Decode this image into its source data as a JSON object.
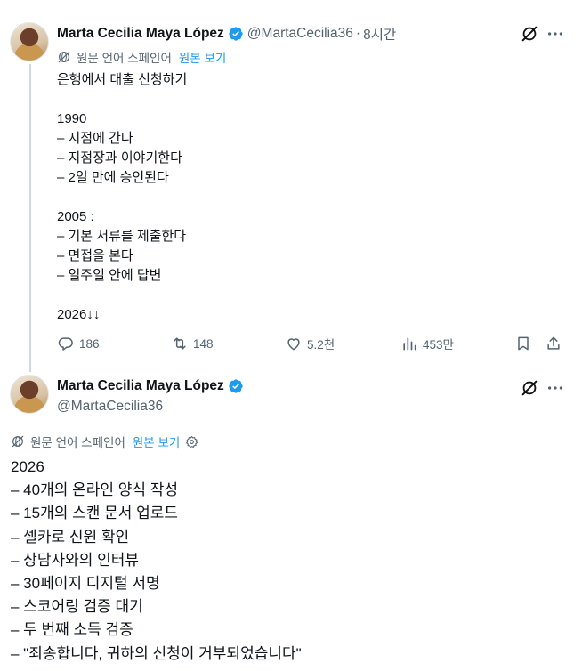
{
  "tweet1": {
    "author_name": "Marta Cecilia Maya López",
    "handle": "@MartaCecilia36",
    "separator": "·",
    "time": "8시간",
    "translation": {
      "label": "원문 언어 스페인어",
      "link": "원본 보기"
    },
    "lines": [
      "은행에서 대출 신청하기",
      "",
      "1990",
      "– 지점에 간다",
      "– 지점장과 이야기한다",
      "– 2일 만에 승인된다",
      "",
      "2005 :",
      "– 기본 서류를 제출한다",
      "– 면접을 본다",
      "– 일주일 안에 답변",
      "",
      "2026↓↓"
    ],
    "actions": {
      "replies": "186",
      "retweets": "148",
      "likes": "5.2천",
      "views": "453만"
    }
  },
  "tweet2": {
    "author_name": "Marta Cecilia Maya López",
    "handle": "@MartaCecilia36",
    "translation": {
      "label": "원문 언어 스페인어",
      "link": "원본 보기"
    },
    "lines": [
      "2026",
      "– 40개의 온라인 양식 작성",
      "– 15개의 스캔 문서 업로드",
      "– 셀카로 신원 확인",
      "– 상담사와의 인터뷰",
      "– 30페이지 디지털 서명",
      "– 스코어링 검증 대기",
      "– 두 번째 소득 검증",
      "– \"죄송합니다, 귀하의 신청이 거부되었습니다\""
    ]
  },
  "colors": {
    "text": "#0f1419",
    "secondary": "#536471",
    "link": "#1d9bf0",
    "verified": "#1d9bf0",
    "thread_line": "#cfd9de"
  },
  "icons": [
    "verified-badge-icon",
    "grok-icon",
    "more-icon",
    "translate-globe-icon",
    "settings-gear-icon",
    "reply-icon",
    "retweet-icon",
    "like-icon",
    "views-icon",
    "bookmark-icon",
    "share-icon"
  ]
}
